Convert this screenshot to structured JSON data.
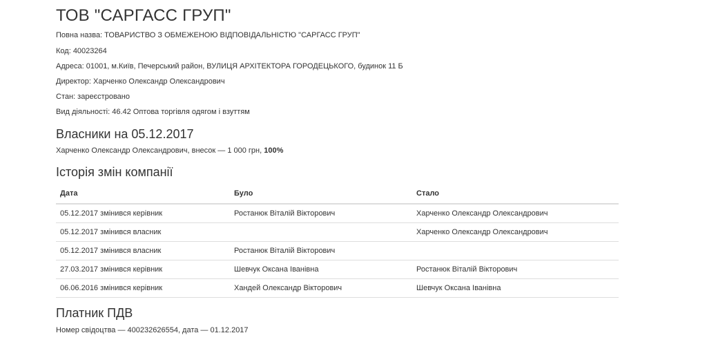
{
  "company": {
    "title": "ТОВ \"САРГАСС ГРУП\"",
    "full_name": "Повна назва: ТОВАРИСТВО З ОБМЕЖЕНОЮ ВІДПОВІДАЛЬНІСТЮ \"САРГАСС ГРУП\"",
    "code": "Код: 40023264",
    "address": "Адреса: 01001, м.Київ, Печерський район, ВУЛИЦЯ АРХІТЕКТОРА ГОРОДЕЦЬКОГО, будинок 11 Б",
    "director": "Директор: Харченко Олександр Олександрович",
    "status": "Стан: зареєстровано",
    "activity": "Вид діяльності: 46.42 Оптова торгівля одягом і взуттям"
  },
  "owners": {
    "title": "Власники на 05.12.2017",
    "entry_text": "Харченко Олександр Олександрович, внесок — 1 000 грн, ",
    "entry_share": "100%"
  },
  "history": {
    "title": "Історія змін компанії",
    "columns": [
      "Дата",
      "Було",
      "Стало"
    ],
    "rows": [
      {
        "date": "05.12.2017 змінився керівник",
        "was": "Ростанюк Віталій Вікторович",
        "now": "Харченко Олександр Олександрович"
      },
      {
        "date": "05.12.2017 змінився власник",
        "was": "",
        "now": "Харченко Олександр Олександрович"
      },
      {
        "date": "05.12.2017 змінився власник",
        "was": "Ростанюк Віталій Вікторович",
        "now": ""
      },
      {
        "date": "27.03.2017 змінився керівник",
        "was": "Шевчук Оксана Іванівна",
        "now": "Ростанюк Віталій Вікторович"
      },
      {
        "date": "06.06.2016 змінився керівник",
        "was": "Хандей Олександр Вікторович",
        "now": "Шевчук Оксана Іванівна"
      }
    ]
  },
  "vat": {
    "title": "Платник ПДВ",
    "certificate": "Номер свідоцтва — 400232626554, дата — 01.12.2017"
  }
}
